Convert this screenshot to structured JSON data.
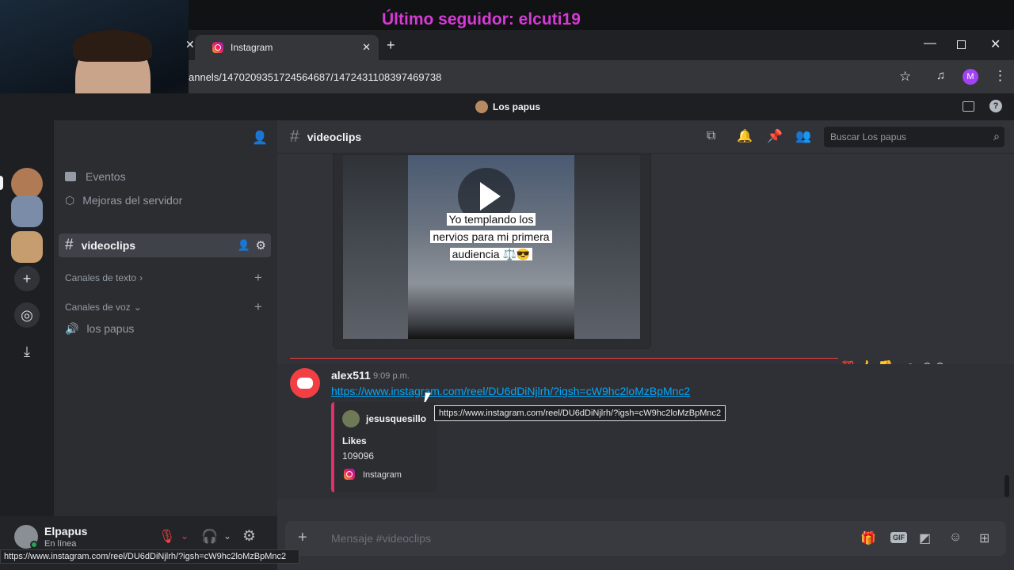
{
  "overlay": {
    "text": "Último seguidor: elcuti19"
  },
  "browser": {
    "tab_title": "Instagram",
    "url": "annels/1470209351724564687/1472431108397469738",
    "profile_initial": "M"
  },
  "server": {
    "name": "Los papus"
  },
  "sidebar": {
    "events": "Eventos",
    "boosts": "Mejoras del servidor",
    "active_channel": "videoclips",
    "text_category": "Canales de texto",
    "voice_category": "Canales de voz",
    "voice_channel": "los papus"
  },
  "channel": {
    "name": "videoclips",
    "search_placeholder": "Buscar Los papus"
  },
  "video": {
    "caption_line1": "Yo templando los",
    "caption_line2": "nervios para mi primera",
    "caption_line3": "audiencia ⚖️😎"
  },
  "message": {
    "author": "alex511",
    "time": "9:09 p.m.",
    "link": "https://www.instagram.com/reel/DU6dDiNjlrh/?igsh=cW9hc2loMzBpMnc2",
    "tooltip": "https://www.instagram.com/reel/DU6dDiNjlrh/?igsh=cW9hc2loMzBpMnc2",
    "embed": {
      "author": "jesusquesillo",
      "field_name": "Likes",
      "field_value": "109096",
      "provider": "Instagram"
    }
  },
  "user": {
    "name": "Elpapus",
    "status": "En línea"
  },
  "composer": {
    "placeholder": "Mensaje #videoclips"
  },
  "statusbar": {
    "text": "https://www.instagram.com/reel/DU6dDiNjlrh/?igsh=cW9hc2loMzBpMnc2"
  },
  "colors": {
    "accent": "#5865f2",
    "link": "#00a8fc",
    "overlay": "#d63ad6",
    "embed_border": "#e1306c"
  }
}
